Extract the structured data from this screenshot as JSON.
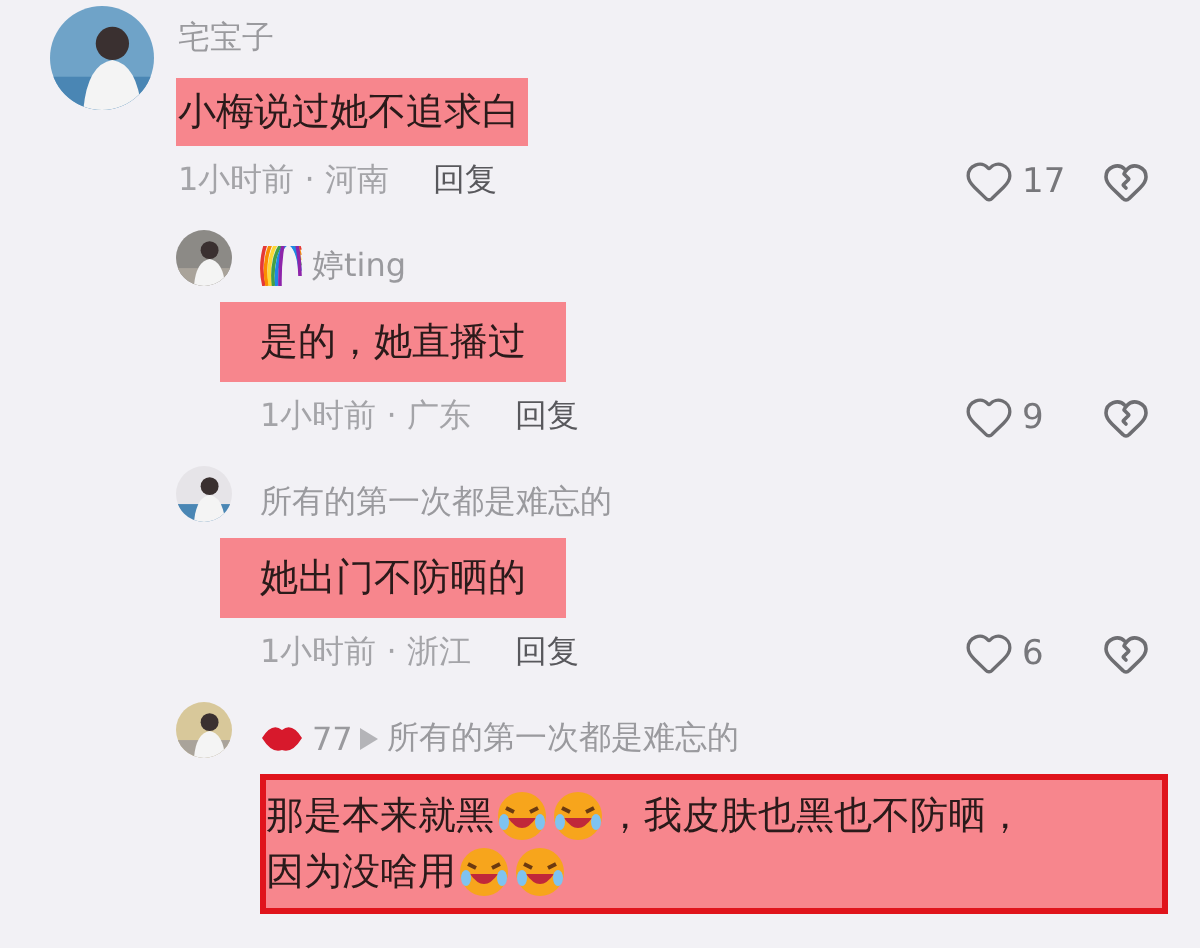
{
  "comments": [
    {
      "author": [
        {
          "kind": "text",
          "text": "宅宝子"
        }
      ],
      "highlighted": true,
      "outlined": false,
      "body": [
        {
          "kind": "text",
          "text": "小梅说过她不追求白"
        }
      ],
      "meta": "1小时前 · 河南",
      "reply": "回复",
      "likes": "17",
      "children": [
        {
          "author": [
            {
              "kind": "rainbow"
            },
            {
              "kind": "text",
              "text": "婷ting"
            }
          ],
          "highlighted": true,
          "outlined": false,
          "body": [
            {
              "kind": "text",
              "text": "是的，她直播过"
            }
          ],
          "meta": "1小时前 · 广东",
          "reply": "回复",
          "likes": "9"
        },
        {
          "author": [
            {
              "kind": "text",
              "text": "所有的第一次都是难忘的"
            }
          ],
          "highlighted": true,
          "outlined": false,
          "body": [
            {
              "kind": "text",
              "text": "她出门不防晒的"
            }
          ],
          "meta": "1小时前 · 浙江",
          "reply": "回复",
          "likes": "6"
        },
        {
          "author": [
            {
              "kind": "lips"
            },
            {
              "kind": "text",
              "text": "77"
            }
          ],
          "reply_to": "所有的第一次都是难忘的",
          "highlighted": true,
          "outlined": true,
          "body": [
            {
              "kind": "text",
              "text": "那是本来就黑"
            },
            {
              "kind": "laugh"
            },
            {
              "kind": "laugh"
            },
            {
              "kind": "text",
              "text": "，我皮肤也黑也不防晒，"
            },
            {
              "kind": "text",
              "text": "因为没啥用"
            },
            {
              "kind": "laugh"
            },
            {
              "kind": "laugh"
            }
          ]
        }
      ]
    }
  ]
}
